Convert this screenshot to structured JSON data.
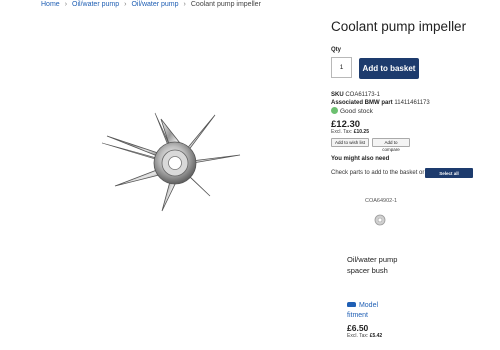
{
  "breadcrumb": {
    "items": [
      "Home",
      "Oil/water pump",
      "Oil/water pump"
    ],
    "current": "Coolant pump impeller"
  },
  "product": {
    "title": "Coolant pump impeller",
    "qty_label": "Qty",
    "qty_value": "1",
    "add_to_basket": "Add to basket",
    "sku_label": "SKU",
    "sku": "COA61173-1",
    "bmw_label": "Associated BMW part",
    "bmw_part": "11411461173",
    "stock": "Good stock",
    "stock_color": "#6cc070",
    "price": "£12.30",
    "excl_label": "Excl. Tax:",
    "excl_price": "£10.25",
    "wish_list": "Add to wish list",
    "compare": "Add to compare"
  },
  "related": {
    "heading": "You might also need",
    "check_text": "Check parts to add to the basket or",
    "select_all": "Select all",
    "item": {
      "sku": "COA64902-1",
      "name": "Oil/water pump spacer bush",
      "fitment": "Model fitment",
      "price": "£6.50",
      "excl_label": "Excl. Tax:",
      "excl_price": "£5.42"
    }
  },
  "colors": {
    "accent": "#1d3b6d",
    "link": "#1f5fb4"
  }
}
